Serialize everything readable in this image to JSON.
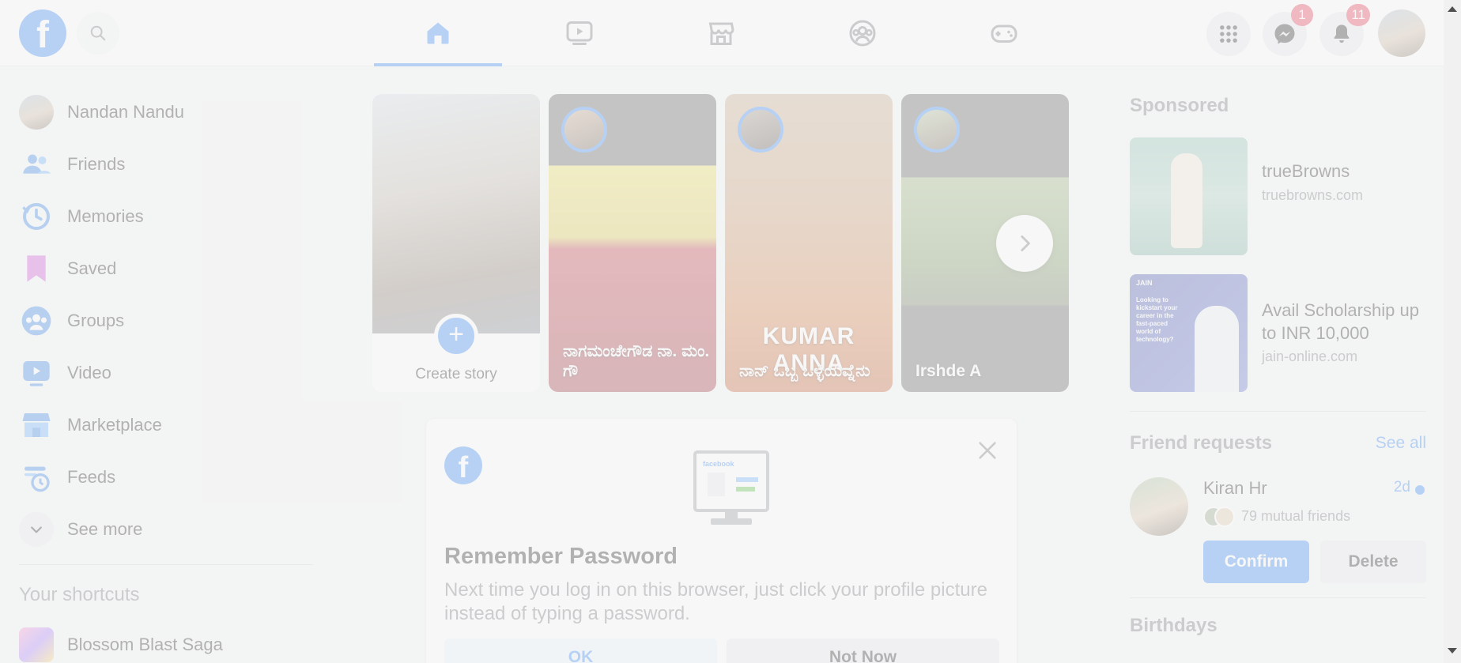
{
  "topbar": {
    "logo_letter": "f",
    "nav_tabs": [
      {
        "name": "home-icon"
      },
      {
        "name": "video-icon"
      },
      {
        "name": "marketplace-icon"
      },
      {
        "name": "groups-icon"
      },
      {
        "name": "gaming-icon"
      }
    ],
    "messenger_badge": "1",
    "notifications_badge": "11",
    "accent": "#1877f2",
    "badge_color": "#e41e3f"
  },
  "sidebar": {
    "items": [
      {
        "label": "Nandan Nandu",
        "icon": "profile-avatar"
      },
      {
        "label": "Friends",
        "icon": "friends-icon"
      },
      {
        "label": "Memories",
        "icon": "memories-icon"
      },
      {
        "label": "Saved",
        "icon": "saved-icon"
      },
      {
        "label": "Groups",
        "icon": "groups-icon"
      },
      {
        "label": "Video",
        "icon": "video-icon"
      },
      {
        "label": "Marketplace",
        "icon": "marketplace-icon"
      },
      {
        "label": "Feeds",
        "icon": "feeds-icon"
      },
      {
        "label": "See more",
        "icon": "chevron-down-icon"
      }
    ],
    "shortcuts_title": "Your shortcuts",
    "shortcuts": [
      {
        "label": "Blossom Blast Saga",
        "icon": "game-icon"
      }
    ]
  },
  "stories": {
    "create_label": "Create story",
    "items": [
      {
        "name": "ನಾಗಮಂಚೇಗೌಡ ನಾ. ಮಂ. ಗೌ"
      },
      {
        "name": "ನಾನ್ ಒಬ್ಬ ಒಳ್ಳೆಯವ್ನೆನು",
        "overlay_text": "KUMAR ANNA"
      },
      {
        "name": "Irshde A"
      }
    ]
  },
  "remember_password": {
    "title": "Remember Password",
    "description": "Next time you log in on this browser, just click your profile picture instead of typing a password.",
    "ok_label": "OK",
    "not_now_label": "Not Now",
    "illustration_text": "facebook"
  },
  "right": {
    "sponsored_title": "Sponsored",
    "ads": [
      {
        "name": "trueBrowns",
        "site": "truebrowns.com"
      },
      {
        "name": "Avail Scholarship up to INR 10,000",
        "site": "jain-online.com",
        "thumb_brand": "JAIN",
        "thumb_text": "Looking to kickstart your career in the fast-paced world of technology?"
      }
    ],
    "friend_requests_title": "Friend requests",
    "see_all": "See all",
    "request": {
      "name": "Kiran Hr",
      "time": "2d",
      "mutual": "79 mutual friends",
      "confirm": "Confirm",
      "delete": "Delete"
    },
    "birthdays_title": "Birthdays"
  }
}
